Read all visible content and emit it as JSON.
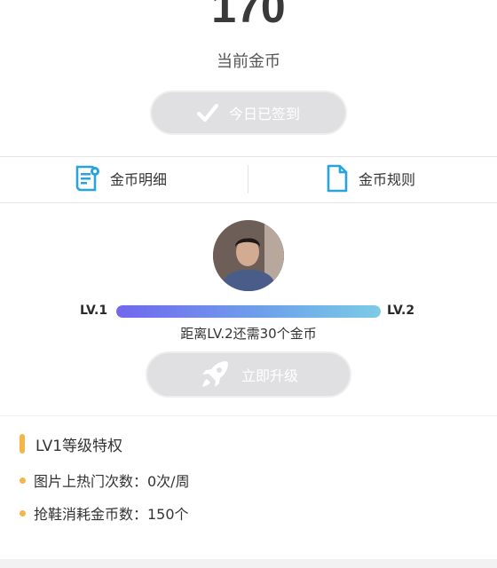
{
  "coins": {
    "value": "170",
    "label": "当前金币"
  },
  "checkin": {
    "label": "今日已签到",
    "icon": "checkmark-icon"
  },
  "tabs": [
    {
      "label": "金币明细",
      "icon": "receipt-icon",
      "icon_color": "#29a3e0"
    },
    {
      "label": "金币规则",
      "icon": "document-icon",
      "icon_color": "#29a3e0"
    }
  ],
  "level": {
    "current": "LV.1",
    "next": "LV.2",
    "progress": 1.0,
    "hint": "距离LV.2还需30个金币",
    "bar_colors": [
      "#7167ee",
      "#7ccbe6"
    ]
  },
  "upgrade": {
    "label": "立即升级",
    "icon": "rocket-icon"
  },
  "privileges": {
    "title": "LV1等级特权",
    "accent": "#f5b54a",
    "items": [
      {
        "label": "图片上热门次数：0次/周"
      },
      {
        "label": "抢鞋消耗金币数：150个"
      }
    ]
  }
}
